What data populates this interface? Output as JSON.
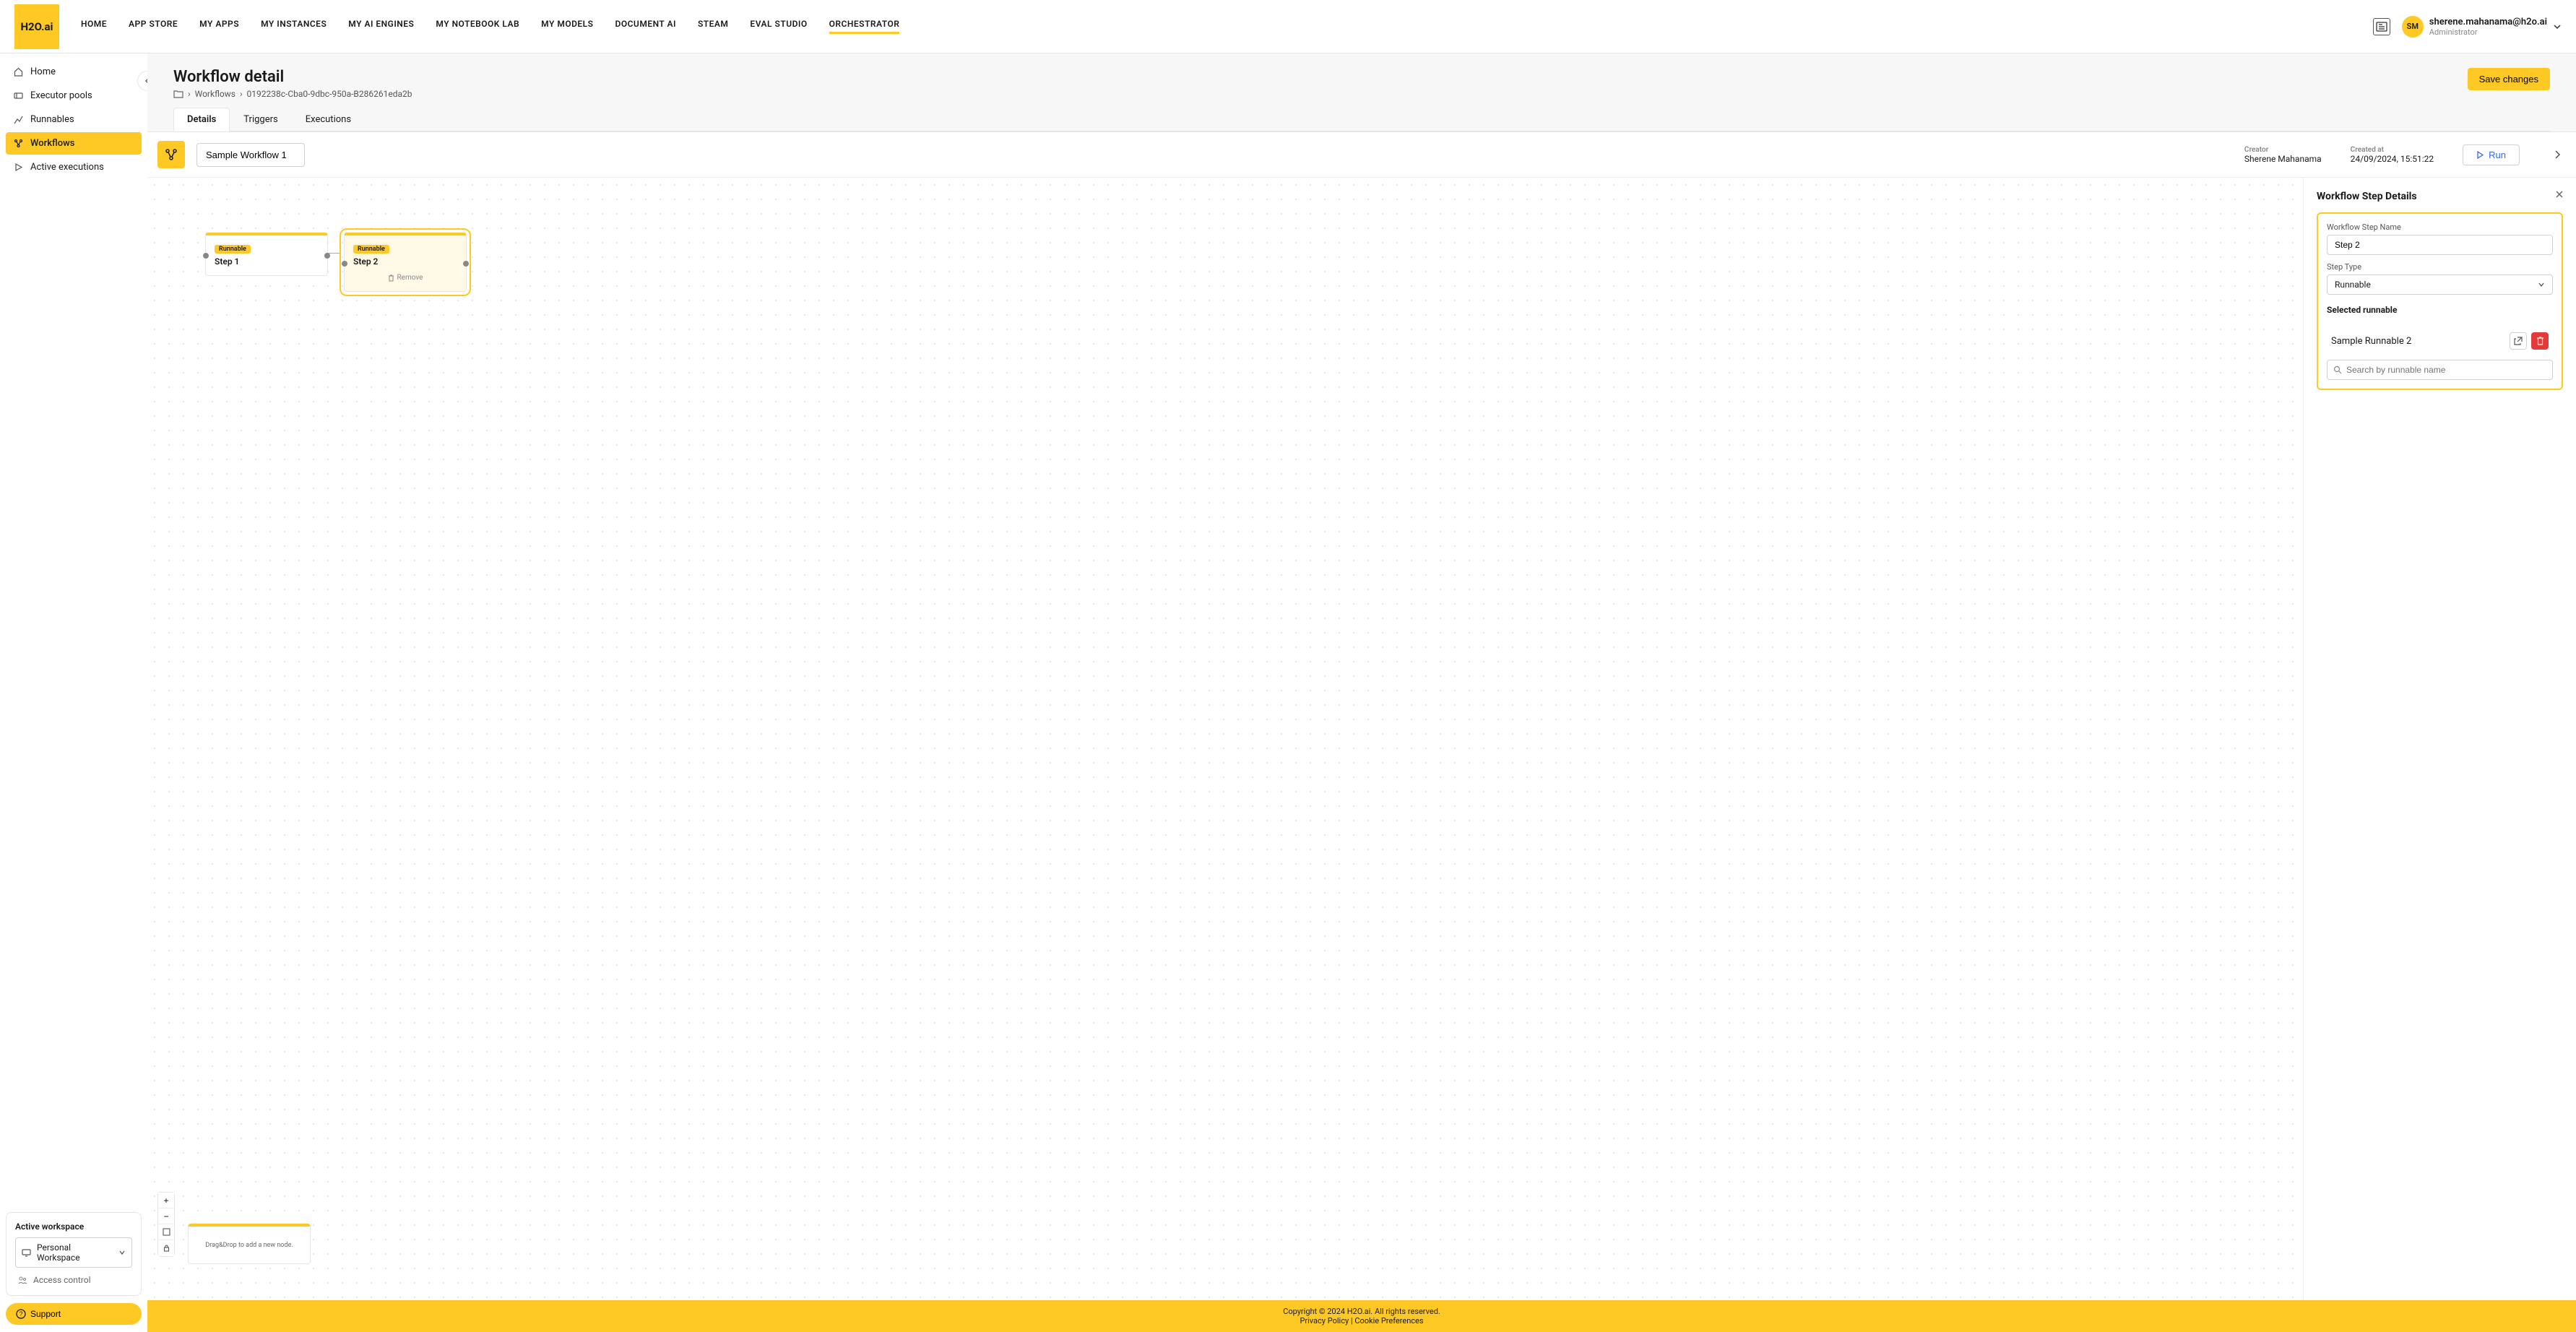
{
  "brand": "H2O.ai",
  "nav": {
    "items": [
      "HOME",
      "APP STORE",
      "MY APPS",
      "MY INSTANCES",
      "MY AI ENGINES",
      "MY NOTEBOOK LAB",
      "MY MODELS",
      "DOCUMENT AI",
      "STEAM",
      "EVAL STUDIO",
      "ORCHESTRATOR"
    ],
    "active_index": 10
  },
  "user": {
    "initials": "SM",
    "email": "sherene.mahanama@h2o.ai",
    "role": "Administrator"
  },
  "sidebar": {
    "items": [
      {
        "label": "Home"
      },
      {
        "label": "Executor pools"
      },
      {
        "label": "Runnables"
      },
      {
        "label": "Workflows"
      },
      {
        "label": "Active executions"
      }
    ],
    "active_index": 3,
    "workspace_label": "Active workspace",
    "workspace_value": "Personal Workspace",
    "access_control": "Access control",
    "support": "Support"
  },
  "page": {
    "title": "Workflow detail",
    "breadcrumb": {
      "root": "Workflows",
      "id": "0192238c-Cba0-9dbc-950a-B286261eda2b"
    },
    "save_label": "Save changes",
    "tabs": [
      "Details",
      "Triggers",
      "Executions"
    ],
    "active_tab": 0
  },
  "toolbar": {
    "name_value": "Sample Workflow 1",
    "creator_label": "Creator",
    "creator_value": "Sherene Mahanama",
    "created_label": "Created at",
    "created_value": "24/09/2024, 15:51:22",
    "run_label": "Run"
  },
  "nodes": [
    {
      "tag": "Runnable",
      "title": "Step 1"
    },
    {
      "tag": "Runnable",
      "title": "Step 2",
      "remove_label": "Remove"
    }
  ],
  "canvas": {
    "drag_hint": "Drag&Drop to add a new node."
  },
  "panel": {
    "title": "Workflow Step Details",
    "name_label": "Workflow Step Name",
    "name_value": "Step 2",
    "type_label": "Step Type",
    "type_value": "Runnable",
    "selected_label": "Selected runnable",
    "selected_value": "Sample Runnable 2",
    "search_placeholder": "Search by runnable name"
  },
  "footer": {
    "copyright": "Copyright © 2024 H2O.ai. All rights reserved.",
    "privacy": "Privacy Policy",
    "sep": " | ",
    "cookie": "Cookie Preferences"
  }
}
